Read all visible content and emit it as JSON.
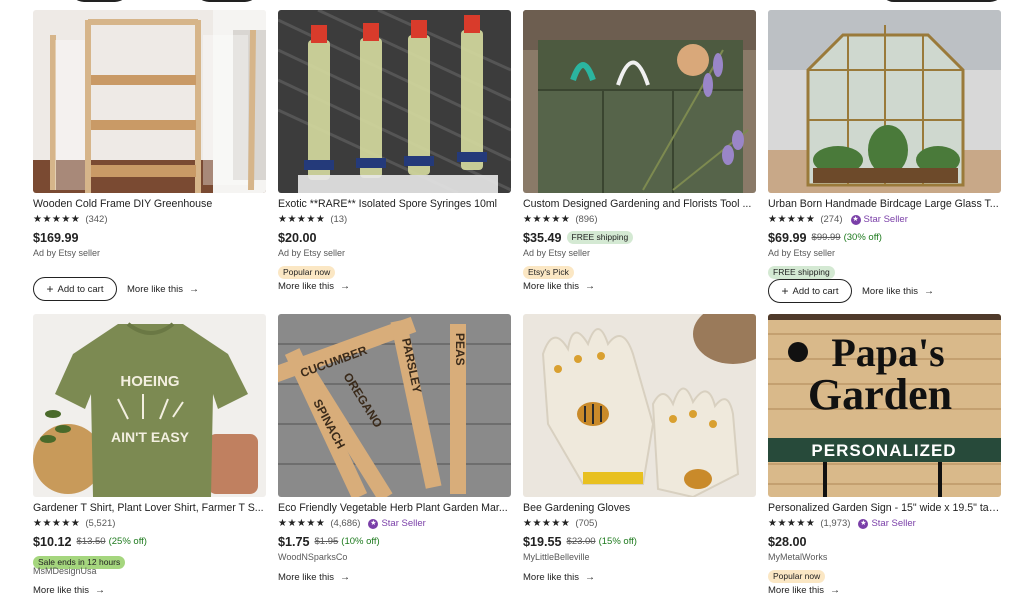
{
  "listings": [
    {
      "title": "Wooden Cold Frame DIY Greenhouse",
      "stars": "★★★★★",
      "reviews": "(342)",
      "star_seller": "",
      "price": "$169.99",
      "orig_price": "",
      "discount": "",
      "free_shipping_inline": "",
      "seller": "Ad by Etsy seller",
      "badge": "",
      "cart": "Add to cart",
      "more": "More like this"
    },
    {
      "title": "Exotic **RARE** Isolated Spore Syringes 10ml",
      "stars": "★★★★★",
      "reviews": "(13)",
      "star_seller": "",
      "price": "$20.00",
      "orig_price": "",
      "discount": "",
      "free_shipping_inline": "",
      "seller": "Ad by Etsy seller",
      "badge": "Popular now",
      "cart": "",
      "more": "More like this"
    },
    {
      "title": "Custom Designed Gardening and Florists Tool ...",
      "stars": "★★★★★",
      "reviews": "(896)",
      "star_seller": "",
      "price": "$35.49",
      "orig_price": "",
      "discount": "",
      "free_shipping_inline": "FREE shipping",
      "seller": "Ad by Etsy seller",
      "badge": "Etsy's Pick",
      "cart": "",
      "more": "More like this"
    },
    {
      "title": "Urban Born Handmade Birdcage Large Glass T...",
      "stars": "★★★★★",
      "reviews": "(274)",
      "star_seller": "Star Seller",
      "price": "$69.99",
      "orig_price": "$99.99",
      "discount": "(30% off)",
      "free_shipping_inline": "",
      "seller": "Ad by Etsy seller",
      "badge": "FREE shipping",
      "cart": "Add to cart",
      "more": "More like this"
    },
    {
      "title": "Gardener T Shirt, Plant Lover Shirt, Farmer T S...",
      "stars": "★★★★★",
      "reviews": "(5,521)",
      "star_seller": "",
      "price": "$10.12",
      "orig_price": "$13.50",
      "discount": "(25% off)",
      "free_shipping_inline": "",
      "seller": "MsMDesignUsa",
      "badge": "Sale ends in 12 hours",
      "cart": "",
      "more": "More like this"
    },
    {
      "title": "Eco Friendly Vegetable Herb Plant Garden Mar...",
      "stars": "★★★★★",
      "reviews": "(4,686)",
      "star_seller": "Star Seller",
      "price": "$1.75",
      "orig_price": "$1.95",
      "discount": "(10% off)",
      "free_shipping_inline": "",
      "seller": "WoodNSparksCo",
      "badge": "",
      "cart": "",
      "more": "More like this"
    },
    {
      "title": "Bee Gardening Gloves",
      "stars": "★★★★★",
      "reviews": "(705)",
      "star_seller": "",
      "price": "$19.55",
      "orig_price": "$23.00",
      "discount": "(15% off)",
      "free_shipping_inline": "",
      "seller": "MyLittleBelleville",
      "badge": "",
      "cart": "",
      "more": "More like this"
    },
    {
      "title": "Personalized Garden Sign - 15\" wide x 19.5\" tall ...",
      "stars": "★★★★★",
      "reviews": "(1,973)",
      "star_seller": "Star Seller",
      "price": "$28.00",
      "orig_price": "",
      "discount": "",
      "free_shipping_inline": "",
      "seller": "MyMetalWorks",
      "badge": "Popular now",
      "cart": "",
      "more": "More like this"
    }
  ],
  "image_text": {
    "markers": [
      "CUCUMBER",
      "PARSLEY",
      "PEAS",
      "OREGANO",
      "SPINACH"
    ],
    "sign_line1": "Papa's",
    "sign_line2": "Garden",
    "sign_banner": "PERSONALIZED",
    "shirt_line1": "HOEING",
    "shirt_line2": "AIN'T EASY"
  },
  "colors": {
    "star_seller": "#7a3fa8",
    "free_shipping_bg": "#d4e9d3",
    "popular_bg": "#fbe7c4",
    "sale_bg": "#a5d67e",
    "discount": "#1e7a1e"
  },
  "icons": {
    "add": "plus-icon",
    "more": "arrow-right-icon",
    "rating": "star-icon",
    "seller_badge": "star-seller-badge-icon"
  }
}
